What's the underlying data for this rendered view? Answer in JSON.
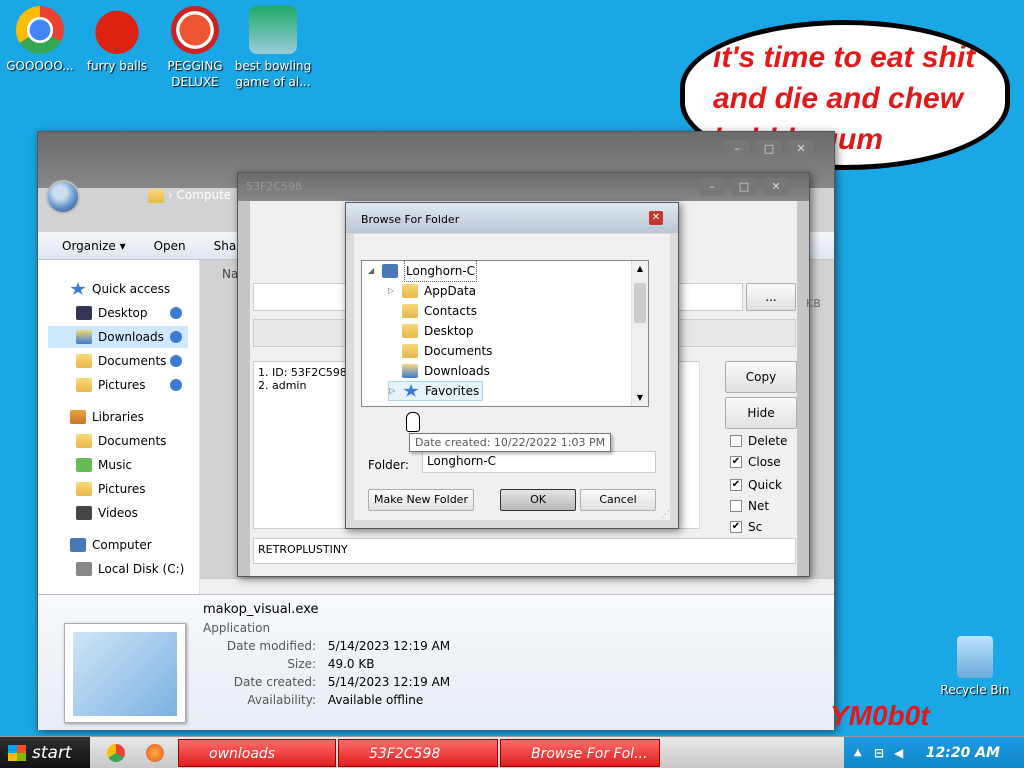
{
  "desktop": {
    "icons": [
      {
        "label": "GOOOOO..."
      },
      {
        "label": "furry balls"
      },
      {
        "label": "PEGGING DELUXE"
      },
      {
        "label": "best bowling game of al..."
      },
      {
        "label": "Recycle Bin"
      }
    ],
    "bubble_text": "it's time to eat shit and die and chew bubble gum",
    "watermark": "YM0b0t"
  },
  "explorer": {
    "breadcrumb": "Compute",
    "toolbar": [
      "Organize ▾",
      "Open",
      "Shar"
    ],
    "column_header": "Na",
    "nav": {
      "quick_access": "Quick access",
      "desktop": "Desktop",
      "downloads": "Downloads",
      "documents": "Documents",
      "pictures": "Pictures",
      "libraries": "Libraries",
      "lib_documents": "Documents",
      "lib_music": "Music",
      "lib_pictures": "Pictures",
      "lib_videos": "Videos",
      "computer": "Computer",
      "local_disk": "Local Disk (C:)"
    },
    "details": {
      "filename": "makop_visual.exe",
      "type": "Application",
      "rows": [
        {
          "label": "Date modified:",
          "value": "5/14/2023 12:19 AM"
        },
        {
          "label": "Size:",
          "value": "49.0 KB"
        },
        {
          "label": "Date created:",
          "value": "5/14/2023 12:19 AM"
        },
        {
          "label": "Availability:",
          "value": "Available offline"
        }
      ]
    }
  },
  "makop": {
    "title": "53F2C598",
    "browse_button": "...",
    "info_line1": "1. ID: 53F2C598",
    "info_line2": "2. admin",
    "copy_button": "Copy",
    "hide_button": "Hide",
    "checkboxes": [
      {
        "label": "Delete",
        "checked": ""
      },
      {
        "label": "Close",
        "checked": "✔"
      },
      {
        "label": "Quick",
        "checked": "✔"
      },
      {
        "label": "Net",
        "checked": ""
      },
      {
        "label": "Sc",
        "checked": "✔"
      }
    ],
    "bottom_field": "RETROPLUSTINY",
    "size_kb": "KB"
  },
  "browse": {
    "title": "Browse For Folder",
    "tree": [
      {
        "label": "Longhorn-C",
        "expander": "◢"
      },
      {
        "label": "AppData",
        "expander": "▷"
      },
      {
        "label": "Contacts",
        "expander": ""
      },
      {
        "label": "Desktop",
        "expander": ""
      },
      {
        "label": "Documents",
        "expander": ""
      },
      {
        "label": "Downloads",
        "expander": ""
      },
      {
        "label": "Favorites",
        "expander": "▷"
      }
    ],
    "tooltip": "Date created: 10/22/2022 1:03 PM",
    "folder_label": "Folder:",
    "folder_value": "Longhorn-C",
    "make_new_folder": "Make New Folder",
    "ok": "OK",
    "cancel": "Cancel"
  },
  "taskbar": {
    "start": "start",
    "tasks": [
      "ownloads",
      "53F2C598",
      "Browse For Fol..."
    ],
    "clock": "12:20 AM"
  }
}
